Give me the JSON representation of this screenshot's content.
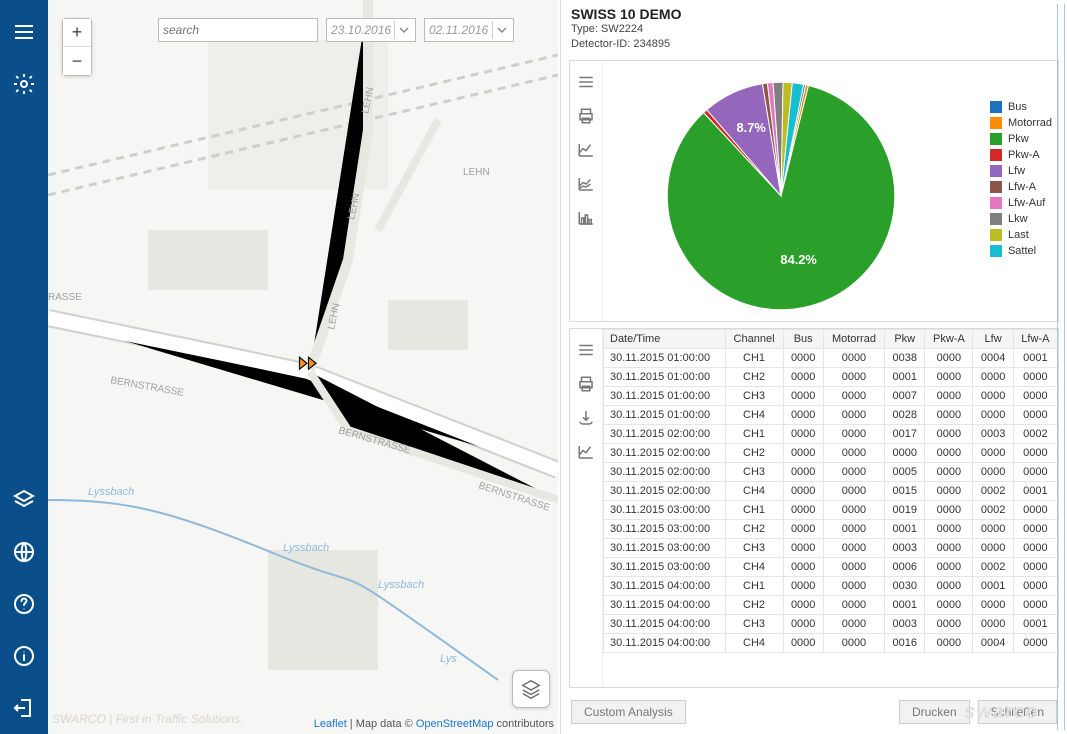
{
  "sidebar": {
    "items": [
      "menu",
      "settings",
      "layers",
      "globe",
      "help",
      "info",
      "exit"
    ]
  },
  "search": {
    "placeholder": "search"
  },
  "dates": {
    "from": "23.10.2016",
    "to": "02.11.2016"
  },
  "map": {
    "roads": [
      "RASSE",
      "BERNSTRASSE",
      "BERNSTRASSE",
      "BERNSTRASSE",
      "LEHN",
      "LEHN",
      "LEHN",
      "LEHN"
    ],
    "streams": [
      "Lyssbach",
      "Lyssbach",
      "Lyssbach",
      "Lys"
    ],
    "attrib_prefix": "Leaflet",
    "attrib_mid": " | Map data © ",
    "attrib_link": "OpenStreetMap",
    "attrib_suffix": " contributors",
    "footer": "SWARCO | First in Traffic Solutions."
  },
  "detail": {
    "title": "SWISS 10 DEMO",
    "type_label": "Type:",
    "type_value": "SW2224",
    "id_label": "Detector-ID:",
    "id_value": "234895"
  },
  "chart_data": {
    "type": "pie",
    "title": "",
    "series": [
      {
        "name": "Bus",
        "value": 0.3,
        "color": "#1e73be"
      },
      {
        "name": "Motorrad",
        "value": 0.4,
        "color": "#ff8c00"
      },
      {
        "name": "Pkw",
        "value": 84.2,
        "color": "#2aa02a",
        "label": "84.2%"
      },
      {
        "name": "Pkw-A",
        "value": 0.6,
        "color": "#d62728"
      },
      {
        "name": "Lfw",
        "value": 8.7,
        "color": "#9467bd",
        "label": "8.7%"
      },
      {
        "name": "Lfw-A",
        "value": 0.7,
        "color": "#8c564b"
      },
      {
        "name": "Lfw-Auf",
        "value": 0.8,
        "color": "#e377c2"
      },
      {
        "name": "Lkw",
        "value": 1.4,
        "color": "#7f7f7f"
      },
      {
        "name": "Last",
        "value": 1.3,
        "color": "#bcbd22"
      },
      {
        "name": "Sattel",
        "value": 1.6,
        "color": "#17becf"
      }
    ]
  },
  "table": {
    "headers": [
      "Date/Time",
      "Channel",
      "Bus",
      "Motorrad",
      "Pkw",
      "Pkw-A",
      "Lfw",
      "Lfw-A"
    ],
    "rows": [
      [
        "30.11.2015 01:00:00",
        "CH1",
        "0000",
        "0000",
        "0038",
        "0000",
        "0004",
        "0001"
      ],
      [
        "30.11.2015 01:00:00",
        "CH2",
        "0000",
        "0000",
        "0001",
        "0000",
        "0000",
        "0000"
      ],
      [
        "30.11.2015 01:00:00",
        "CH3",
        "0000",
        "0000",
        "0007",
        "0000",
        "0000",
        "0000"
      ],
      [
        "30.11.2015 01:00:00",
        "CH4",
        "0000",
        "0000",
        "0028",
        "0000",
        "0000",
        "0000"
      ],
      [
        "30.11.2015 02:00:00",
        "CH1",
        "0000",
        "0000",
        "0017",
        "0000",
        "0003",
        "0002"
      ],
      [
        "30.11.2015 02:00:00",
        "CH2",
        "0000",
        "0000",
        "0000",
        "0000",
        "0000",
        "0000"
      ],
      [
        "30.11.2015 02:00:00",
        "CH3",
        "0000",
        "0000",
        "0005",
        "0000",
        "0000",
        "0000"
      ],
      [
        "30.11.2015 02:00:00",
        "CH4",
        "0000",
        "0000",
        "0015",
        "0000",
        "0002",
        "0001"
      ],
      [
        "30.11.2015 03:00:00",
        "CH1",
        "0000",
        "0000",
        "0019",
        "0000",
        "0002",
        "0000"
      ],
      [
        "30.11.2015 03:00:00",
        "CH2",
        "0000",
        "0000",
        "0001",
        "0000",
        "0000",
        "0000"
      ],
      [
        "30.11.2015 03:00:00",
        "CH3",
        "0000",
        "0000",
        "0003",
        "0000",
        "0000",
        "0000"
      ],
      [
        "30.11.2015 03:00:00",
        "CH4",
        "0000",
        "0000",
        "0006",
        "0000",
        "0002",
        "0000"
      ],
      [
        "30.11.2015 04:00:00",
        "CH1",
        "0000",
        "0000",
        "0030",
        "0000",
        "0001",
        "0000"
      ],
      [
        "30.11.2015 04:00:00",
        "CH2",
        "0000",
        "0000",
        "0001",
        "0000",
        "0000",
        "0000"
      ],
      [
        "30.11.2015 04:00:00",
        "CH3",
        "0000",
        "0000",
        "0003",
        "0000",
        "0000",
        "0001"
      ],
      [
        "30.11.2015 04:00:00",
        "CH4",
        "0000",
        "0000",
        "0016",
        "0000",
        "0004",
        "0000"
      ]
    ]
  },
  "buttons": {
    "custom": "Custom Analysis",
    "print": "Drucken",
    "close": "Schließen"
  },
  "brand": "swarco"
}
